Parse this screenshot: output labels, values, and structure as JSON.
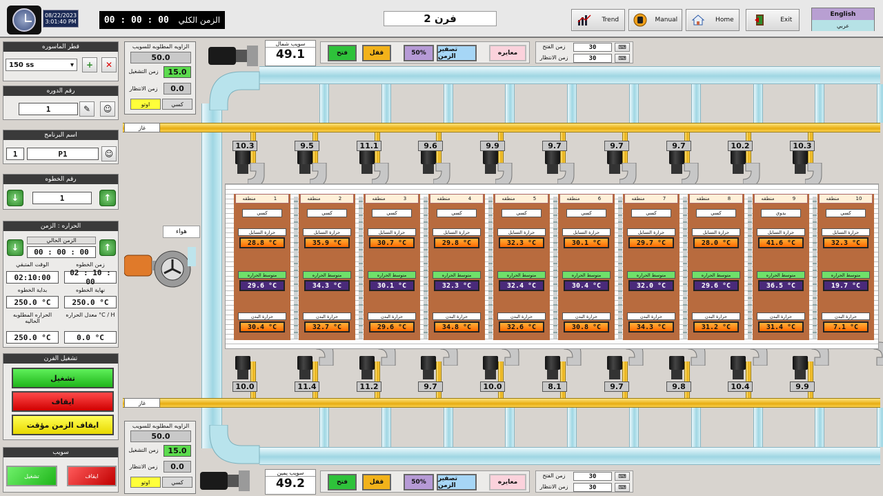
{
  "header": {
    "date": "08/22/2023",
    "time": "3:01:40 PM",
    "total_time_label": "الزمن الكلي",
    "total_time_value": "00 : 00 : 00",
    "oven_title": "فرن 2",
    "nav": [
      {
        "label": "Trend",
        "icon": "chart-icon"
      },
      {
        "label": "Manual",
        "icon": "hand-icon"
      },
      {
        "label": "Home",
        "icon": "home-icon"
      },
      {
        "label": "Exit",
        "icon": "exit-door-icon"
      }
    ],
    "lang_en": "English",
    "lang_ar": "عربي"
  },
  "sidebar": {
    "pipe_diameter": {
      "title": "قطر الماسوره",
      "value": "150 ss"
    },
    "cycle_number": {
      "title": "رقم الدوره",
      "value": "1"
    },
    "program_name": {
      "title": "اسم البرنامج",
      "number": "1",
      "name": "P1"
    },
    "step_number": {
      "title": "رقم الخطوه",
      "value": "1"
    },
    "temp_time": {
      "title": "الحراره : الزمن",
      "current_time_label": "الزمن الحالي",
      "current_time": "00 : 00 : 00",
      "remaining_label": "الوقت المتبقي",
      "remaining": "02:10:00",
      "step_time_label": "زمن الخطوه",
      "step_time": "02 : 10 : 00",
      "step_start_label": "بداية الخطوه",
      "step_start": "250.0 °C",
      "step_end_label": "نهاية الخطوه",
      "step_end": "250.0 °C",
      "required_temp_label": "الحراره المطلوبه الحاليه",
      "required_temp": "250.0 °C",
      "temp_rate_label": "معدل الحراره °C / H",
      "temp_rate": "0.0 °C"
    },
    "oven_operation": {
      "title": "تشغيل الفرن",
      "start": "تشغيل",
      "stop": "ايقاف",
      "pause": "ايقاف الزمن مؤقت"
    },
    "swing": {
      "title": "سويب",
      "run": "تشغيل",
      "stop": "ايقاف"
    }
  },
  "top_control": {
    "required_angle_label": "الزاويه المطلوبه للسويب",
    "required_angle": "50.0",
    "on_time_label": "زمن التشغيل",
    "on_time": "15.0",
    "wait_time_label": "زمن الانتظار",
    "wait_time": "0.0",
    "auto": "اوتو",
    "manual": "كسي",
    "swing_label": "سويب شمال",
    "swing_value": "49.1",
    "buttons": {
      "open": "فتح",
      "close": "قفل",
      "percent": "50%",
      "reset_time": "تصفير الزمن",
      "calibration": "معايره"
    },
    "open_time_label": "زمن الفتح",
    "open_time": "30",
    "wait_time2_label": "زمن الانتظار",
    "wait_time2": "30"
  },
  "bottom_control": {
    "required_angle_label": "الزاويه المطلوبه للسويب",
    "required_angle": "50.0",
    "on_time_label": "زمن التشغيل",
    "on_time": "15.0",
    "wait_time_label": "زمن الانتظار",
    "wait_time": "0.0",
    "auto": "اوتو",
    "manual": "كسي",
    "swing_label": "سويب يمين",
    "swing_value": "49.2",
    "buttons": {
      "open": "فتح",
      "close": "قفل",
      "percent": "50%",
      "reset_time": "تصفير الزمن",
      "calibration": "معايره"
    },
    "open_time_label": "زمن الفتح",
    "open_time": "30",
    "wait_time2_label": "زمن الانتظار",
    "wait_time2": "30"
  },
  "gas_label": "غاز",
  "air_label": "هواء",
  "top_burners": [
    "10.3",
    "9.5",
    "11.1",
    "9.6",
    "9.9",
    "9.7",
    "9.7",
    "9.7",
    "10.2",
    "10.3"
  ],
  "bottom_burners": [
    "10.0",
    "11.4",
    "11.2",
    "9.7",
    "10.0",
    "8.1",
    "9.7",
    "9.8",
    "10.4",
    "9.9"
  ],
  "zones": {
    "zone_word": "منطقه",
    "ceiling_label": "حرارة التسايل",
    "avg_label": "متوسط الحراره",
    "body_label": "حرارة البدن",
    "items": [
      {
        "num": "1",
        "mode": "كسي",
        "ceiling": "28.8 °C",
        "avg": "29.6 °C",
        "body": "30.4 °C"
      },
      {
        "num": "2",
        "mode": "كسي",
        "ceiling": "35.9 °C",
        "avg": "34.3 °C",
        "body": "32.7 °C"
      },
      {
        "num": "3",
        "mode": "كسي",
        "ceiling": "30.7 °C",
        "avg": "30.1 °C",
        "body": "29.6 °C"
      },
      {
        "num": "4",
        "mode": "كسي",
        "ceiling": "29.8 °C",
        "avg": "32.3 °C",
        "body": "34.8 °C"
      },
      {
        "num": "5",
        "mode": "كسي",
        "ceiling": "32.3 °C",
        "avg": "32.4 °C",
        "body": "32.6 °C"
      },
      {
        "num": "6",
        "mode": "كسي",
        "ceiling": "30.1 °C",
        "avg": "30.4 °C",
        "body": "30.8 °C"
      },
      {
        "num": "7",
        "mode": "كسي",
        "ceiling": "29.7 °C",
        "avg": "32.0 °C",
        "body": "34.3 °C"
      },
      {
        "num": "8",
        "mode": "كسي",
        "ceiling": "28.0 °C",
        "avg": "29.6 °C",
        "body": "31.2 °C"
      },
      {
        "num": "9",
        "mode": "يدوي",
        "ceiling": "41.6 °C",
        "avg": "36.5 °C",
        "body": "31.4 °C"
      },
      {
        "num": "10",
        "mode": "كسي",
        "ceiling": "32.3 °C",
        "avg": "19.7 °C",
        "body": "7.1 °C"
      }
    ]
  }
}
